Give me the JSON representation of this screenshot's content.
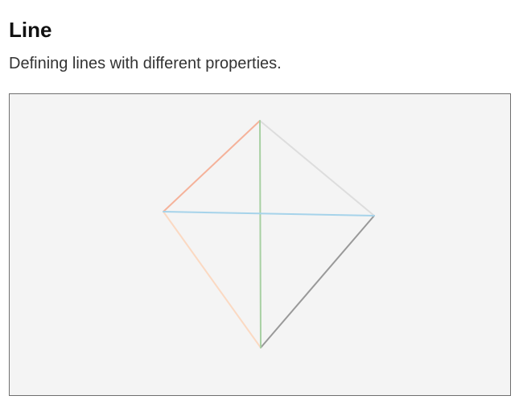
{
  "page": {
    "title": "Line",
    "subtitle": "Defining lines with different properties."
  },
  "canvas": {
    "background_color": "#f4f4f4",
    "border_color": "#6f6f6f",
    "lines": [
      {
        "name": "top-left-line",
        "color": "#f5b29a",
        "opacity": 1.0
      },
      {
        "name": "top-right-line",
        "color": "#dddddd",
        "opacity": 1.0
      },
      {
        "name": "bottom-left-line",
        "color": "#fbd9c2",
        "opacity": 1.0
      },
      {
        "name": "bottom-right-line",
        "color": "#999999",
        "opacity": 1.0
      },
      {
        "name": "vertical-line",
        "color": "#a7d0a2",
        "opacity": 1.0
      },
      {
        "name": "horizontal-line",
        "color": "#a6d3ea",
        "opacity": 1.0
      }
    ]
  }
}
